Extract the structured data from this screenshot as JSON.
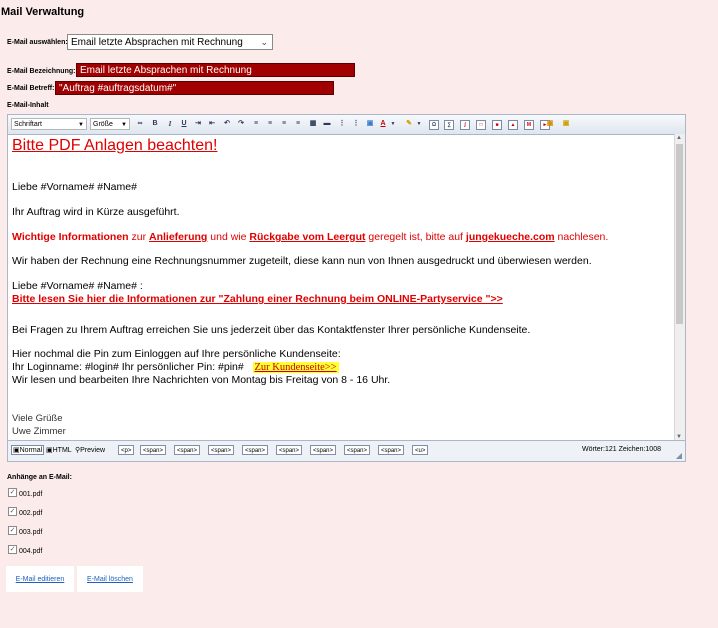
{
  "page": {
    "title": "Mail Verwaltung"
  },
  "select_mail": {
    "label": "E-Mail auswählen:",
    "value": "Email letzte Absprachen mit Rechnung"
  },
  "bezeichnung": {
    "label": "E-Mail Bezeichnung:",
    "value": "Email letzte Absprachen mit Rechnung"
  },
  "betreff": {
    "label": "E-Mail Betreff:",
    "value": "\"Auftrag #auftragsdatum#\""
  },
  "inhalt": {
    "label": "E-Mail-Inhalt"
  },
  "toolbar": {
    "font": "Schriftart",
    "size": "Größe",
    "bold": "B",
    "italic": "I",
    "underline": "U"
  },
  "content": {
    "heading": "Bitte PDF Anlagen beachten!",
    "greeting": "Liebe  #Vorname# #Name#",
    "line1": "Ihr Auftrag wird in Kürze ausgeführt.",
    "info_a": "Wichtige Informationen",
    "info_b": " zur ",
    "info_c": "Anlieferung",
    "info_d": " und wie ",
    "info_e": "Rückgabe vom Leergut",
    "info_f": " geregelt ist, bitte auf ",
    "info_g": "jungekueche.com",
    "info_h": " nachlesen.",
    "line2": "Wir haben der Rechnung eine  Rechnungsnummer zugeteilt, diese kann nun von Ihnen ausgedruckt und überwiesen werden.",
    "greeting2": "Liebe  #Vorname# #Name# :",
    "payment_link": "Bitte lesen Sie hier die Informationen zur \"Zahlung einer Rechnung beim ONLINE-Partyservice \">>",
    "line3": "Bei Fragen zu Ihrem Auftrag erreichen Sie uns jederzeit über das Kontaktfenster Ihrer persönliche Kundenseite.",
    "line4": "Hier nochmal die Pin zum Einloggen auf Ihre persönliche Kundenseite:",
    "line5": "Ihr Loginname: #login#  Ihr persönlicher Pin: #pin#",
    "kunden_link": "Zur Kundenseite>>",
    "line6": "Wir lesen und bearbeiten Ihre Nachrichten von Montag bis Freitag von 8 - 16 Uhr.",
    "sign1": "Viele Grüße",
    "sign2": "Uwe Zimmer"
  },
  "bottombar": {
    "modes": [
      "Normal",
      "HTML",
      "Preview"
    ],
    "tags": [
      "<p>",
      "<span>",
      "<span>",
      "<span>",
      "<span>",
      "<span>",
      "<span>",
      "<span>",
      "<span>",
      "<u>"
    ],
    "counter": "Wörter:121 Zeichen:1008"
  },
  "attachments": {
    "label": "Anhänge an E-Mail:",
    "files": [
      {
        "name": "001.pdf",
        "checked": true
      },
      {
        "name": "002.pdf",
        "checked": true
      },
      {
        "name": "003.pdf",
        "checked": true
      },
      {
        "name": "004.pdf",
        "checked": true
      }
    ]
  },
  "actions": {
    "edit": "E-Mail editieren",
    "delete": "E-Mail löschen"
  }
}
